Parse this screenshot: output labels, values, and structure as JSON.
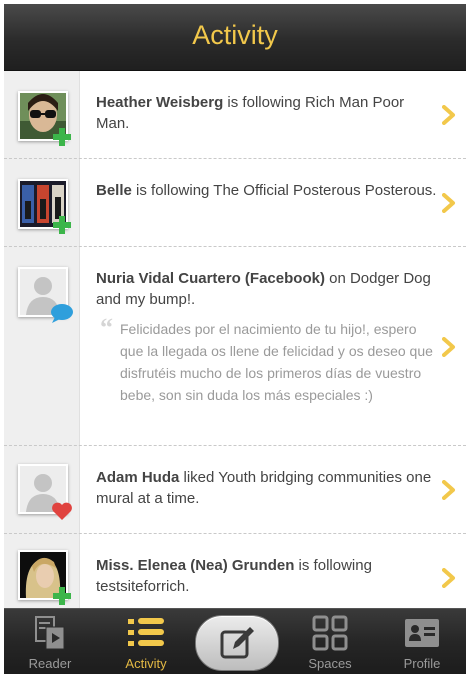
{
  "header": {
    "title": "Activity"
  },
  "feed": [
    {
      "name": "Heather Weisberg",
      "text": " is following Rich Man Poor Man.",
      "badge": "plus"
    },
    {
      "name": "Belle",
      "text": " is following The Official Posterous Posterous.",
      "badge": "plus"
    },
    {
      "name": "Nuria Vidal Cuartero (Facebook)",
      "text": " on Dodger Dog and my bump!.",
      "badge": "comment",
      "quote": "Felicidades por el nacimiento de tu hijo!, espero que la llegada os llene de felicidad y os deseo que disfrutéis mucho de los primeros días de vuestro bebe, son sin duda los más especiales :)"
    },
    {
      "name": "Adam Huda",
      "text": " liked Youth bridging communities one mural at a time.",
      "badge": "heart"
    },
    {
      "name": "Miss. Elenea (Nea)  Grunden",
      "text": " is following testsiteforrich.",
      "badge": "plus"
    }
  ],
  "tabs": {
    "reader": "Reader",
    "activity": "Activity",
    "spaces": "Spaces",
    "profile": "Profile"
  },
  "colors": {
    "accent": "#f2c84b",
    "plus": "#3cb54a",
    "comment": "#2f9fdc",
    "heart": "#e0433f"
  },
  "icons": [
    "reader-icon",
    "activity-list-icon",
    "compose-icon",
    "spaces-grid-icon",
    "profile-card-icon",
    "chevron-right-icon"
  ]
}
